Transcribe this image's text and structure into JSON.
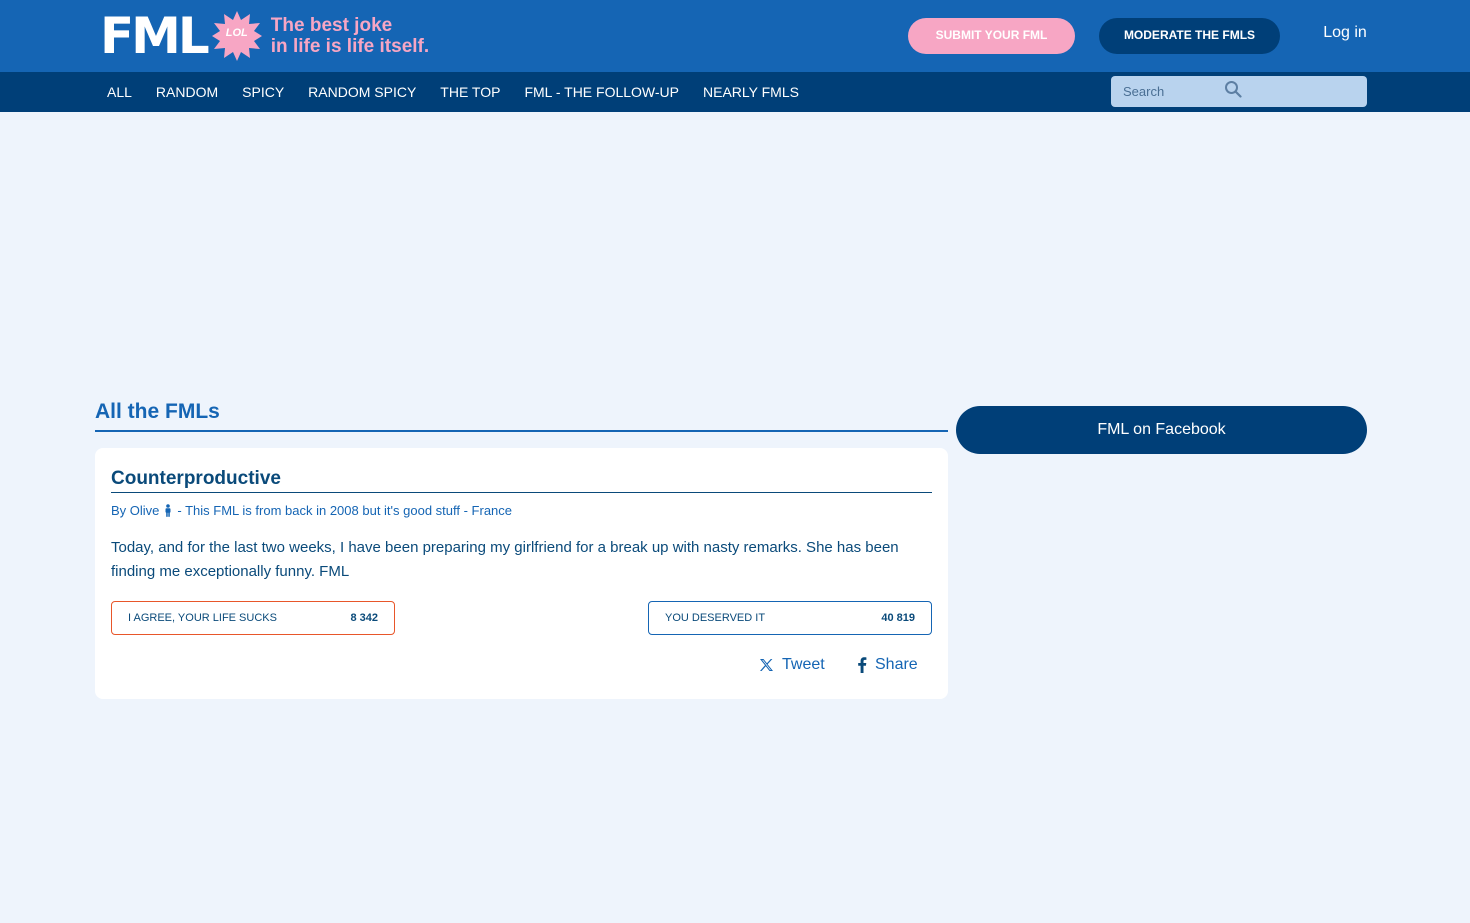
{
  "header": {
    "logo_text": "FML",
    "logo_badge": "LOL",
    "tagline_line1": "The best joke",
    "tagline_line2": "in life is life itself.",
    "submit_label": "SUBMIT YOUR FML",
    "moderate_label": "MODERATE THE FMLS",
    "login_label": "Log in",
    "colors": {
      "header_bg": "#1565b4",
      "nav_bg": "#003f78",
      "accent_pink": "#f7a6c4"
    }
  },
  "nav": {
    "items": [
      "ALL",
      "RANDOM",
      "SPICY",
      "RANDOM SPICY",
      "THE TOP",
      "FML - THE FOLLOW-UP",
      "NEARLY FMLS"
    ]
  },
  "search": {
    "placeholder": "Search",
    "icon": "search-icon"
  },
  "main": {
    "section_title": "All the FMLs",
    "post": {
      "title": "Counterproductive",
      "author_prefix": "By Olive",
      "author_icon": "male-person-icon",
      "meta_suffix": "- This FML is from back in 2008 but it's good stuff - France",
      "text": "Today, and for the last two weeks, I have been preparing my girlfriend for a break up with nasty remarks. She has been finding me exceptionally funny. FML",
      "vote_agree": {
        "label": "I agree, your life sucks",
        "count": "8 342",
        "color": "#e8562a"
      },
      "vote_deserved": {
        "label": "You deserved it",
        "count": "40 819",
        "color": "#1565b4"
      },
      "tweet_label": "Tweet",
      "share_label": "Share"
    }
  },
  "sidebar": {
    "facebook_label": "FML on Facebook"
  }
}
